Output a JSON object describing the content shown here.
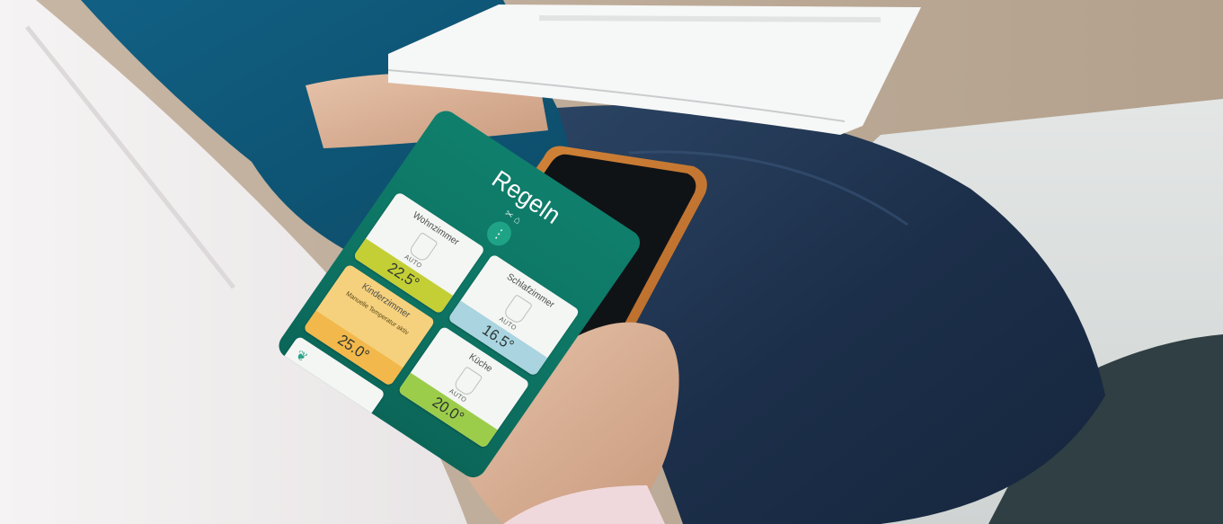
{
  "phone_app": {
    "title": "Regeln",
    "header_icons": [
      "tools-icon",
      "home-icon"
    ],
    "menu_icon": "ellipsis-vertical-icon",
    "tiles": [
      {
        "name": "Wohnzimmer",
        "mode": "AUTO",
        "value": "22.5°",
        "color": "#c3cf35"
      },
      {
        "name": "Schlafzimmer",
        "mode": "AUTO",
        "value": "16.5°",
        "color": "#a9d4e0"
      },
      {
        "name": "Kinderzimmer",
        "note": "Manuelle Temperatur aktiv",
        "value": "25.0°",
        "color": "#f2b84b"
      },
      {
        "name": "Küche",
        "mode": "AUTO",
        "value": "20.0°",
        "color": "#9ccd4a"
      }
    ],
    "bottom_icon": "plant-icon"
  },
  "colors": {
    "app_green": "#0f7f6c",
    "case_orange": "#c8782e",
    "sofa_grey": "#d9dcdb",
    "jeans_blue": "#1d2f47",
    "shirt_teal": "#0f5570",
    "sweater_white": "#f1efef"
  }
}
